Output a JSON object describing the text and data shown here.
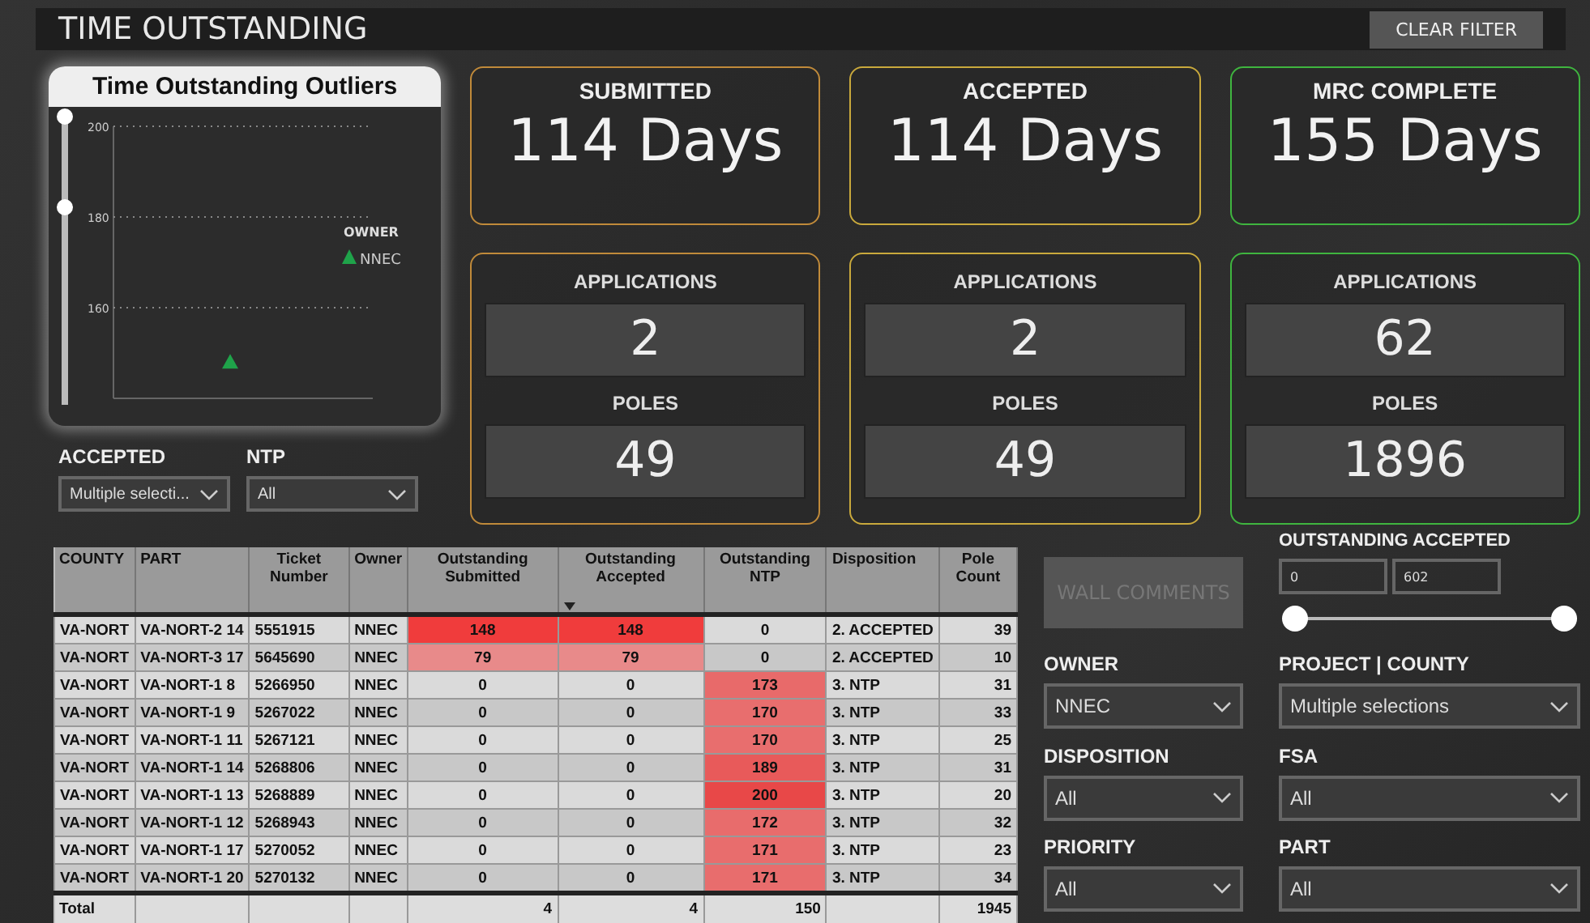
{
  "header": {
    "title": "TIME OUTSTANDING",
    "clear_button": "CLEAR FILTER"
  },
  "outliers": {
    "title": "Time Outstanding Outliers",
    "legend_title": "OWNER",
    "chart_data": {
      "type": "scatter",
      "ylim": [
        140,
        200
      ],
      "yticks": [
        160,
        180,
        200
      ],
      "series": [
        {
          "name": "NNEC",
          "color": "#1fa34a",
          "values": [
            148
          ]
        }
      ]
    }
  },
  "left_filters": [
    {
      "label": "ACCEPTED",
      "value": "Multiple selecti..."
    },
    {
      "label": "NTP",
      "value": "All"
    }
  ],
  "summary_cards": [
    {
      "title": "SUBMITTED",
      "value": "114 Days",
      "color": "#c08a3a",
      "applications_label": "APPLICATIONS",
      "applications": "2",
      "poles_label": "POLES",
      "poles": "49"
    },
    {
      "title": "ACCEPTED",
      "value": "114 Days",
      "color": "#c9a93c",
      "applications_label": "APPLICATIONS",
      "applications": "2",
      "poles_label": "POLES",
      "poles": "49"
    },
    {
      "title": "MRC COMPLETE",
      "value": "155 Days",
      "color": "#3fb53f",
      "applications_label": "APPLICATIONS",
      "applications": "62",
      "poles_label": "POLES",
      "poles": "1896"
    }
  ],
  "table": {
    "columns": [
      {
        "label": "COUNTY",
        "sorted": false
      },
      {
        "label": "PART",
        "sorted": false
      },
      {
        "label": "Ticket Number",
        "sorted": false
      },
      {
        "label": "Owner",
        "sorted": false
      },
      {
        "label": "Outstanding Submitted",
        "sorted": false
      },
      {
        "label": "Outstanding Accepted",
        "sorted": true
      },
      {
        "label": "Outstanding NTP",
        "sorted": false
      },
      {
        "label": "Disposition",
        "sorted": false
      },
      {
        "label": "Pole Count",
        "sorted": false
      }
    ],
    "rows": [
      [
        {
          "text": "VA-NORT"
        },
        {
          "text": "VA-NORT-2 14"
        },
        {
          "text": "5551915"
        },
        {
          "text": "NNEC"
        },
        {
          "text": "148",
          "color": "#f03c3c"
        },
        {
          "text": "148",
          "color": "#f03c3c"
        },
        {
          "text": "0"
        },
        {
          "text": "2. ACCEPTED"
        },
        {
          "text": "39"
        }
      ],
      [
        {
          "text": "VA-NORT"
        },
        {
          "text": "VA-NORT-3 17"
        },
        {
          "text": "5645690"
        },
        {
          "text": "NNEC"
        },
        {
          "text": "79",
          "color": "#e88a8a"
        },
        {
          "text": "79",
          "color": "#e88a8a"
        },
        {
          "text": "0"
        },
        {
          "text": "2. ACCEPTED"
        },
        {
          "text": "10"
        }
      ],
      [
        {
          "text": "VA-NORT"
        },
        {
          "text": "VA-NORT-1 8"
        },
        {
          "text": "5266950"
        },
        {
          "text": "NNEC"
        },
        {
          "text": "0"
        },
        {
          "text": "0"
        },
        {
          "text": "173",
          "color": "#e86a6a"
        },
        {
          "text": "3. NTP"
        },
        {
          "text": "31"
        }
      ],
      [
        {
          "text": "VA-NORT"
        },
        {
          "text": "VA-NORT-1 9"
        },
        {
          "text": "5267022"
        },
        {
          "text": "NNEC"
        },
        {
          "text": "0"
        },
        {
          "text": "0"
        },
        {
          "text": "170",
          "color": "#e86e6e"
        },
        {
          "text": "3. NTP"
        },
        {
          "text": "33"
        }
      ],
      [
        {
          "text": "VA-NORT"
        },
        {
          "text": "VA-NORT-1 11"
        },
        {
          "text": "5267121"
        },
        {
          "text": "NNEC"
        },
        {
          "text": "0"
        },
        {
          "text": "0"
        },
        {
          "text": "170",
          "color": "#e86e6e"
        },
        {
          "text": "3. NTP"
        },
        {
          "text": "25"
        }
      ],
      [
        {
          "text": "VA-NORT"
        },
        {
          "text": "VA-NORT-1 14"
        },
        {
          "text": "5268806"
        },
        {
          "text": "NNEC"
        },
        {
          "text": "0"
        },
        {
          "text": "0"
        },
        {
          "text": "189",
          "color": "#e85a5a"
        },
        {
          "text": "3. NTP"
        },
        {
          "text": "31"
        }
      ],
      [
        {
          "text": "VA-NORT"
        },
        {
          "text": "VA-NORT-1 13"
        },
        {
          "text": "5268889"
        },
        {
          "text": "NNEC"
        },
        {
          "text": "0"
        },
        {
          "text": "0"
        },
        {
          "text": "200",
          "color": "#e84848"
        },
        {
          "text": "3. NTP"
        },
        {
          "text": "20"
        }
      ],
      [
        {
          "text": "VA-NORT"
        },
        {
          "text": "VA-NORT-1 12"
        },
        {
          "text": "5268943"
        },
        {
          "text": "NNEC"
        },
        {
          "text": "0"
        },
        {
          "text": "0"
        },
        {
          "text": "172",
          "color": "#e86c6c"
        },
        {
          "text": "3. NTP"
        },
        {
          "text": "32"
        }
      ],
      [
        {
          "text": "VA-NORT"
        },
        {
          "text": "VA-NORT-1 17"
        },
        {
          "text": "5270052"
        },
        {
          "text": "NNEC"
        },
        {
          "text": "0"
        },
        {
          "text": "0"
        },
        {
          "text": "171",
          "color": "#e86d6d"
        },
        {
          "text": "3. NTP"
        },
        {
          "text": "23"
        }
      ],
      [
        {
          "text": "VA-NORT"
        },
        {
          "text": "VA-NORT-1 20"
        },
        {
          "text": "5270132"
        },
        {
          "text": "NNEC"
        },
        {
          "text": "0"
        },
        {
          "text": "0"
        },
        {
          "text": "171",
          "color": "#e86d6d"
        },
        {
          "text": "3. NTP"
        },
        {
          "text": "34"
        }
      ]
    ],
    "total": {
      "label": "Total",
      "outstanding_submitted": "4",
      "outstanding_accepted": "4",
      "outstanding_ntp": "150",
      "pole_count": "1945"
    }
  },
  "wall_button": {
    "label": "WALL COMMENTS",
    "disabled": true
  },
  "range_filter": {
    "label": "OUTSTANDING ACCEPTED",
    "min": "0",
    "max": "602",
    "level": 1
  },
  "right_filters": [
    {
      "label": "OWNER",
      "value": "NNEC"
    },
    {
      "label": "PROJECT | COUNTY",
      "value": "Multiple selections"
    },
    {
      "label": "DISPOSITION",
      "value": "All"
    },
    {
      "label": "FSA",
      "value": "All"
    },
    {
      "label": "PRIORITY",
      "value": "All"
    },
    {
      "label": "PART",
      "value": "All"
    }
  ]
}
